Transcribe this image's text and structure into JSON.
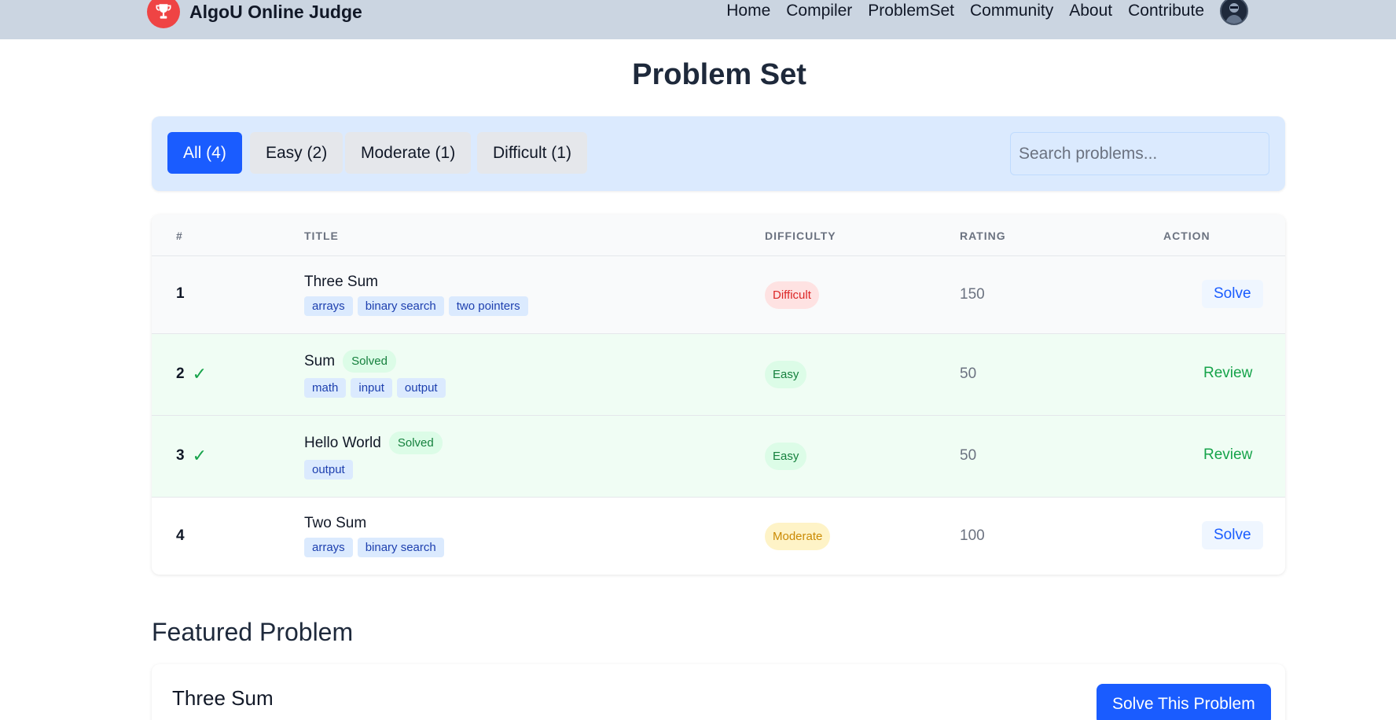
{
  "navbar": {
    "brand": "AlgoU Online Judge",
    "links": [
      "Home",
      "Compiler",
      "ProblemSet",
      "Community",
      "About",
      "Contribute"
    ]
  },
  "page_title": "Problem Set",
  "filters": [
    {
      "label": "All (4)",
      "active": true
    },
    {
      "label": "Easy (2)",
      "active": false
    },
    {
      "label": "Moderate (1)",
      "active": false
    },
    {
      "label": "Difficult (1)",
      "active": false
    }
  ],
  "search": {
    "placeholder": "Search problems...",
    "value": ""
  },
  "table": {
    "headers": {
      "num": "#",
      "title": "TITLE",
      "difficulty": "DIFFICULTY",
      "rating": "RATING",
      "action": "ACTION"
    },
    "rows": [
      {
        "num": "1",
        "solved": false,
        "title": "Three Sum",
        "tags": [
          "arrays",
          "binary search",
          "two pointers"
        ],
        "difficulty": "Difficult",
        "rating": "150",
        "action": "Solve"
      },
      {
        "num": "2",
        "solved": true,
        "solved_label": "Solved",
        "title": "Sum",
        "tags": [
          "math",
          "input",
          "output"
        ],
        "difficulty": "Easy",
        "rating": "50",
        "action": "Review"
      },
      {
        "num": "3",
        "solved": true,
        "solved_label": "Solved",
        "title": "Hello World",
        "tags": [
          "output"
        ],
        "difficulty": "Easy",
        "rating": "50",
        "action": "Review"
      },
      {
        "num": "4",
        "solved": false,
        "title": "Two Sum",
        "tags": [
          "arrays",
          "binary search"
        ],
        "difficulty": "Moderate",
        "rating": "100",
        "action": "Solve"
      }
    ]
  },
  "featured": {
    "heading": "Featured Problem",
    "title": "Three Sum",
    "button": "Solve This Problem"
  },
  "colors": {
    "navbar_bg": "#cbd5e1",
    "primary": "#1a5cff",
    "solved_row_bg": "#f0fdf4",
    "difficult": "#dc2626",
    "easy": "#15803d",
    "moderate": "#ca8a04"
  }
}
